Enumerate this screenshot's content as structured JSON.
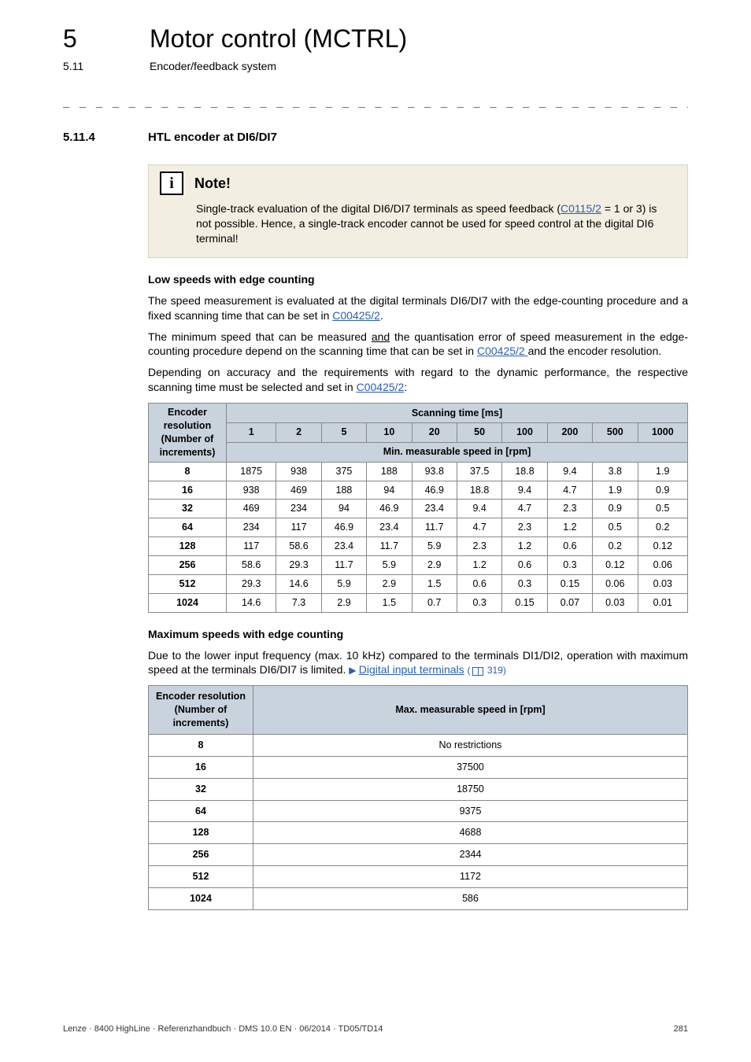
{
  "header": {
    "chapter_num": "5",
    "chapter_title": "Motor control (MCTRL)",
    "sub_num": "5.11",
    "sub_title": "Encoder/feedback system"
  },
  "dashline": "_ _ _ _ _ _ _ _ _ _ _ _ _ _ _ _ _ _ _ _ _ _ _ _ _ _ _ _ _ _ _ _ _ _ _ _ _ _ _ _ _ _ _ _ _ _ _ _ _ _ _ _ _ _ _ _ _ _ _ _ _ _ _ _",
  "section": {
    "num": "5.11.4",
    "title": "HTL encoder at DI6/DI7"
  },
  "note": {
    "title": "Note!",
    "body_pre": "Single-track evaluation of the digital DI6/DI7 terminals as speed feedback (",
    "body_link": "C0115/2",
    "body_post": " = 1 or 3) is not possible. Hence, a single-track encoder cannot be used for speed control at the digital DI6 terminal!"
  },
  "low": {
    "heading": "Low speeds with edge counting",
    "p1_pre": "The speed measurement is evaluated at the digital terminals DI6/DI7 with the edge-counting procedure and a fixed scanning time that can be set in ",
    "p1_link": "C00425/2",
    "p1_post": ".",
    "p2_pre": "The minimum speed that can be measured ",
    "p2_uline": "and",
    "p2_mid": " the quantisation error of speed measurement in the edge-counting procedure depend on the scanning time that can be set in ",
    "p2_link": "C00425/2 ",
    "p2_post": " and the encoder resolution.",
    "p3_pre": "Depending on accuracy and the requirements with regard to the dynamic performance, the respective scanning time must be selected and set in ",
    "p3_link": "C00425/2",
    "p3_post": ":"
  },
  "table1": {
    "left_header": "Encoder resolution (Number of increments)",
    "scan_header": "Scanning time [ms]",
    "scan_cols": [
      "1",
      "2",
      "5",
      "10",
      "20",
      "50",
      "100",
      "200",
      "500",
      "1000"
    ],
    "sub_header": "Min. measurable speed in [rpm]",
    "rows": [
      {
        "inc": "8",
        "vals": [
          "1875",
          "938",
          "375",
          "188",
          "93.8",
          "37.5",
          "18.8",
          "9.4",
          "3.8",
          "1.9"
        ]
      },
      {
        "inc": "16",
        "vals": [
          "938",
          "469",
          "188",
          "94",
          "46.9",
          "18.8",
          "9.4",
          "4.7",
          "1.9",
          "0.9"
        ]
      },
      {
        "inc": "32",
        "vals": [
          "469",
          "234",
          "94",
          "46.9",
          "23.4",
          "9.4",
          "4.7",
          "2.3",
          "0.9",
          "0.5"
        ]
      },
      {
        "inc": "64",
        "vals": [
          "234",
          "117",
          "46.9",
          "23.4",
          "11.7",
          "4.7",
          "2.3",
          "1.2",
          "0.5",
          "0.2"
        ]
      },
      {
        "inc": "128",
        "vals": [
          "117",
          "58.6",
          "23.4",
          "11.7",
          "5.9",
          "2.3",
          "1.2",
          "0.6",
          "0.2",
          "0.12"
        ]
      },
      {
        "inc": "256",
        "vals": [
          "58.6",
          "29.3",
          "11.7",
          "5.9",
          "2.9",
          "1.2",
          "0.6",
          "0.3",
          "0.12",
          "0.06"
        ]
      },
      {
        "inc": "512",
        "vals": [
          "29.3",
          "14.6",
          "5.9",
          "2.9",
          "1.5",
          "0.6",
          "0.3",
          "0.15",
          "0.06",
          "0.03"
        ]
      },
      {
        "inc": "1024",
        "vals": [
          "14.6",
          "7.3",
          "2.9",
          "1.5",
          "0.7",
          "0.3",
          "0.15",
          "0.07",
          "0.03",
          "0.01"
        ]
      }
    ]
  },
  "max": {
    "heading": "Maximum speeds with edge counting",
    "p1_pre": "Due to the lower input frequency (max. 10 kHz) compared to the terminals DI1/DI2, operation with maximum speed at the terminals DI6/DI7 is limited.  ",
    "p1_link": "Digital input terminals",
    "p1_ref": " 319)"
  },
  "table2": {
    "left_header": "Encoder resolution (Number of increments)",
    "right_header": "Max. measurable speed in [rpm]",
    "rows": [
      {
        "inc": "8",
        "val": "No restrictions"
      },
      {
        "inc": "16",
        "val": "37500"
      },
      {
        "inc": "32",
        "val": "18750"
      },
      {
        "inc": "64",
        "val": "9375"
      },
      {
        "inc": "128",
        "val": "4688"
      },
      {
        "inc": "256",
        "val": "2344"
      },
      {
        "inc": "512",
        "val": "1172"
      },
      {
        "inc": "1024",
        "val": "586"
      }
    ]
  },
  "footer": {
    "left": "Lenze · 8400 HighLine · Referenzhandbuch · DMS 10.0 EN · 06/2014 · TD05/TD14",
    "right": "281"
  }
}
